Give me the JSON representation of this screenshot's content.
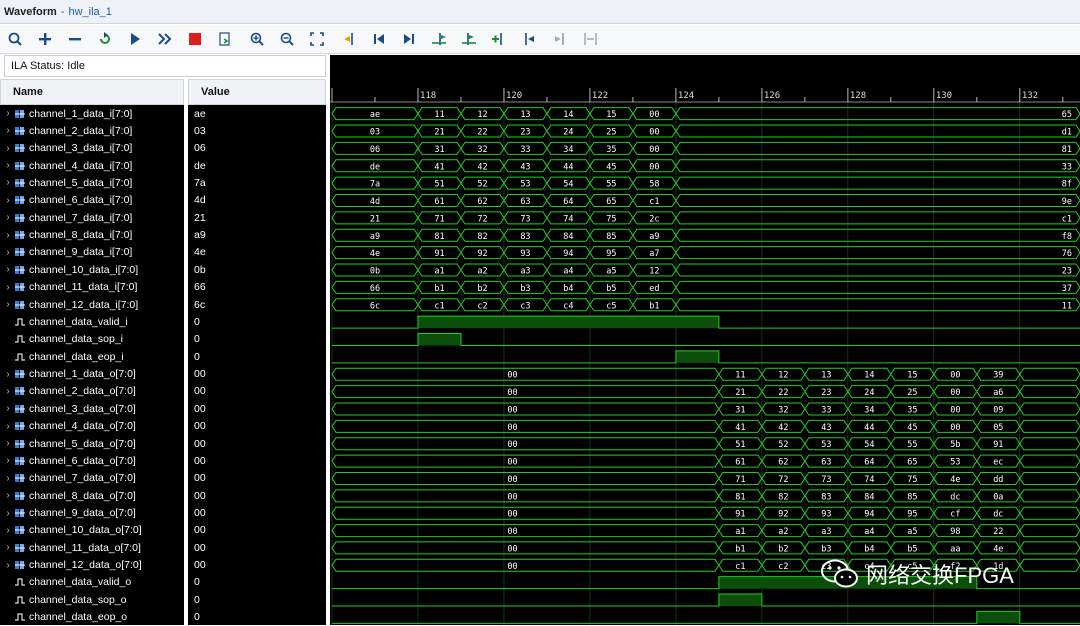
{
  "window": {
    "title": "Waveform",
    "separator": "-",
    "subtitle": "hw_ila_1"
  },
  "toolbar": {
    "buttons": [
      "search-icon",
      "zoom-plus-icon",
      "zoom-minus-icon",
      "refresh-trigger-icon",
      "run-trigger-icon",
      "run-immediate-icon",
      "stop-icon",
      "export-icon",
      "zoom-in-icon",
      "zoom-out-icon",
      "zoom-fit-icon",
      "cursor-icon",
      "go-to-start-icon",
      "go-to-end-icon",
      "add-marker-icon",
      "marker-icon",
      "add-cursor-icon",
      "prev-transition-icon",
      "next-transition-icon",
      "swap-icon"
    ]
  },
  "ila_status": "ILA Status: Idle",
  "columns": {
    "name": "Name",
    "value": "Value"
  },
  "signals": [
    {
      "name": "channel_1_data_i[7:0]",
      "value": "ae",
      "bus": true
    },
    {
      "name": "channel_2_data_i[7:0]",
      "value": "03",
      "bus": true
    },
    {
      "name": "channel_3_data_i[7:0]",
      "value": "06",
      "bus": true
    },
    {
      "name": "channel_4_data_i[7:0]",
      "value": "de",
      "bus": true
    },
    {
      "name": "channel_5_data_i[7:0]",
      "value": "7a",
      "bus": true
    },
    {
      "name": "channel_6_data_i[7:0]",
      "value": "4d",
      "bus": true
    },
    {
      "name": "channel_7_data_i[7:0]",
      "value": "21",
      "bus": true
    },
    {
      "name": "channel_8_data_i[7:0]",
      "value": "a9",
      "bus": true
    },
    {
      "name": "channel_9_data_i[7:0]",
      "value": "4e",
      "bus": true
    },
    {
      "name": "channel_10_data_i[7:0]",
      "value": "0b",
      "bus": true
    },
    {
      "name": "channel_11_data_i[7:0]",
      "value": "66",
      "bus": true
    },
    {
      "name": "channel_12_data_i[7:0]",
      "value": "6c",
      "bus": true
    },
    {
      "name": "channel_data_valid_i",
      "value": "0",
      "bus": false
    },
    {
      "name": "channel_data_sop_i",
      "value": "0",
      "bus": false
    },
    {
      "name": "channel_data_eop_i",
      "value": "0",
      "bus": false
    },
    {
      "name": "channel_1_data_o[7:0]",
      "value": "00",
      "bus": true
    },
    {
      "name": "channel_2_data_o[7:0]",
      "value": "00",
      "bus": true
    },
    {
      "name": "channel_3_data_o[7:0]",
      "value": "00",
      "bus": true
    },
    {
      "name": "channel_4_data_o[7:0]",
      "value": "00",
      "bus": true
    },
    {
      "name": "channel_5_data_o[7:0]",
      "value": "00",
      "bus": true
    },
    {
      "name": "channel_6_data_o[7:0]",
      "value": "00",
      "bus": true
    },
    {
      "name": "channel_7_data_o[7:0]",
      "value": "00",
      "bus": true
    },
    {
      "name": "channel_8_data_o[7:0]",
      "value": "00",
      "bus": true
    },
    {
      "name": "channel_9_data_o[7:0]",
      "value": "00",
      "bus": true
    },
    {
      "name": "channel_10_data_o[7:0]",
      "value": "00",
      "bus": true
    },
    {
      "name": "channel_11_data_o[7:0]",
      "value": "00",
      "bus": true
    },
    {
      "name": "channel_12_data_o[7:0]",
      "value": "00",
      "bus": true
    },
    {
      "name": "channel_data_valid_o",
      "value": "0",
      "bus": false
    },
    {
      "name": "channel_data_sop_o",
      "value": "0",
      "bus": false
    },
    {
      "name": "channel_data_eop_o",
      "value": "0",
      "bus": false
    }
  ],
  "timeline": {
    "labels": [
      "118",
      "120",
      "122",
      "124",
      "126",
      "128",
      "130",
      "132"
    ],
    "start": 116.0,
    "end": 133.4
  },
  "waveforms": [
    {
      "segs": [
        [
          116,
          118,
          "ae"
        ],
        [
          118,
          119,
          "11"
        ],
        [
          119,
          120,
          "12"
        ],
        [
          120,
          121,
          "13"
        ],
        [
          121,
          122,
          "14"
        ],
        [
          122,
          123,
          "15"
        ],
        [
          123,
          124,
          "00"
        ],
        [
          124,
          133.4,
          "65"
        ]
      ]
    },
    {
      "segs": [
        [
          116,
          118,
          "03"
        ],
        [
          118,
          119,
          "21"
        ],
        [
          119,
          120,
          "22"
        ],
        [
          120,
          121,
          "23"
        ],
        [
          121,
          122,
          "24"
        ],
        [
          122,
          123,
          "25"
        ],
        [
          123,
          124,
          "00"
        ],
        [
          124,
          133.4,
          "d1"
        ]
      ]
    },
    {
      "segs": [
        [
          116,
          118,
          "06"
        ],
        [
          118,
          119,
          "31"
        ],
        [
          119,
          120,
          "32"
        ],
        [
          120,
          121,
          "33"
        ],
        [
          121,
          122,
          "34"
        ],
        [
          122,
          123,
          "35"
        ],
        [
          123,
          124,
          "00"
        ],
        [
          124,
          133.4,
          "81"
        ]
      ]
    },
    {
      "segs": [
        [
          116,
          118,
          "de"
        ],
        [
          118,
          119,
          "41"
        ],
        [
          119,
          120,
          "42"
        ],
        [
          120,
          121,
          "43"
        ],
        [
          121,
          122,
          "44"
        ],
        [
          122,
          123,
          "45"
        ],
        [
          123,
          124,
          "00"
        ],
        [
          124,
          133.4,
          "33"
        ]
      ]
    },
    {
      "segs": [
        [
          116,
          118,
          "7a"
        ],
        [
          118,
          119,
          "51"
        ],
        [
          119,
          120,
          "52"
        ],
        [
          120,
          121,
          "53"
        ],
        [
          121,
          122,
          "54"
        ],
        [
          122,
          123,
          "55"
        ],
        [
          123,
          124,
          "58"
        ],
        [
          124,
          133.4,
          "8f"
        ]
      ]
    },
    {
      "segs": [
        [
          116,
          118,
          "4d"
        ],
        [
          118,
          119,
          "61"
        ],
        [
          119,
          120,
          "62"
        ],
        [
          120,
          121,
          "63"
        ],
        [
          121,
          122,
          "64"
        ],
        [
          122,
          123,
          "65"
        ],
        [
          123,
          124,
          "c1"
        ],
        [
          124,
          133.4,
          "9e"
        ]
      ]
    },
    {
      "segs": [
        [
          116,
          118,
          "21"
        ],
        [
          118,
          119,
          "71"
        ],
        [
          119,
          120,
          "72"
        ],
        [
          120,
          121,
          "73"
        ],
        [
          121,
          122,
          "74"
        ],
        [
          122,
          123,
          "75"
        ],
        [
          123,
          124,
          "2c"
        ],
        [
          124,
          133.4,
          "c1"
        ]
      ]
    },
    {
      "segs": [
        [
          116,
          118,
          "a9"
        ],
        [
          118,
          119,
          "81"
        ],
        [
          119,
          120,
          "82"
        ],
        [
          120,
          121,
          "83"
        ],
        [
          121,
          122,
          "84"
        ],
        [
          122,
          123,
          "85"
        ],
        [
          123,
          124,
          "a9"
        ],
        [
          124,
          133.4,
          "f8"
        ]
      ]
    },
    {
      "segs": [
        [
          116,
          118,
          "4e"
        ],
        [
          118,
          119,
          "91"
        ],
        [
          119,
          120,
          "92"
        ],
        [
          120,
          121,
          "93"
        ],
        [
          121,
          122,
          "94"
        ],
        [
          122,
          123,
          "95"
        ],
        [
          123,
          124,
          "a7"
        ],
        [
          124,
          133.4,
          "76"
        ]
      ]
    },
    {
      "segs": [
        [
          116,
          118,
          "0b"
        ],
        [
          118,
          119,
          "a1"
        ],
        [
          119,
          120,
          "a2"
        ],
        [
          120,
          121,
          "a3"
        ],
        [
          121,
          122,
          "a4"
        ],
        [
          122,
          123,
          "a5"
        ],
        [
          123,
          124,
          "12"
        ],
        [
          124,
          133.4,
          "23"
        ]
      ]
    },
    {
      "segs": [
        [
          116,
          118,
          "66"
        ],
        [
          118,
          119,
          "b1"
        ],
        [
          119,
          120,
          "b2"
        ],
        [
          120,
          121,
          "b3"
        ],
        [
          121,
          122,
          "b4"
        ],
        [
          122,
          123,
          "b5"
        ],
        [
          123,
          124,
          "ed"
        ],
        [
          124,
          133.4,
          "37"
        ]
      ]
    },
    {
      "segs": [
        [
          116,
          118,
          "6c"
        ],
        [
          118,
          119,
          "c1"
        ],
        [
          119,
          120,
          "c2"
        ],
        [
          120,
          121,
          "c3"
        ],
        [
          121,
          122,
          "c4"
        ],
        [
          122,
          123,
          "c5"
        ],
        [
          123,
          124,
          "b1"
        ],
        [
          124,
          133.4,
          "11"
        ]
      ]
    },
    {
      "high": [
        [
          118,
          125
        ]
      ]
    },
    {
      "high": [
        [
          118,
          119
        ]
      ]
    },
    {
      "high": [
        [
          124,
          125
        ]
      ]
    },
    {
      "segs": [
        [
          116,
          125,
          "00"
        ],
        [
          125,
          126,
          "11"
        ],
        [
          126,
          127,
          "12"
        ],
        [
          127,
          128,
          "13"
        ],
        [
          128,
          129,
          "14"
        ],
        [
          129,
          130,
          "15"
        ],
        [
          130,
          131,
          "00"
        ],
        [
          131,
          132,
          "39"
        ],
        [
          132,
          133.4,
          ""
        ]
      ]
    },
    {
      "segs": [
        [
          116,
          125,
          "00"
        ],
        [
          125,
          126,
          "21"
        ],
        [
          126,
          127,
          "22"
        ],
        [
          127,
          128,
          "23"
        ],
        [
          128,
          129,
          "24"
        ],
        [
          129,
          130,
          "25"
        ],
        [
          130,
          131,
          "00"
        ],
        [
          131,
          132,
          "a6"
        ],
        [
          132,
          133.4,
          ""
        ]
      ]
    },
    {
      "segs": [
        [
          116,
          125,
          "00"
        ],
        [
          125,
          126,
          "31"
        ],
        [
          126,
          127,
          "32"
        ],
        [
          127,
          128,
          "33"
        ],
        [
          128,
          129,
          "34"
        ],
        [
          129,
          130,
          "35"
        ],
        [
          130,
          131,
          "00"
        ],
        [
          131,
          132,
          "09"
        ],
        [
          132,
          133.4,
          ""
        ]
      ]
    },
    {
      "segs": [
        [
          116,
          125,
          "00"
        ],
        [
          125,
          126,
          "41"
        ],
        [
          126,
          127,
          "42"
        ],
        [
          127,
          128,
          "43"
        ],
        [
          128,
          129,
          "44"
        ],
        [
          129,
          130,
          "45"
        ],
        [
          130,
          131,
          "00"
        ],
        [
          131,
          132,
          "05"
        ],
        [
          132,
          133.4,
          ""
        ]
      ]
    },
    {
      "segs": [
        [
          116,
          125,
          "00"
        ],
        [
          125,
          126,
          "51"
        ],
        [
          126,
          127,
          "52"
        ],
        [
          127,
          128,
          "53"
        ],
        [
          128,
          129,
          "54"
        ],
        [
          129,
          130,
          "55"
        ],
        [
          130,
          131,
          "5b"
        ],
        [
          131,
          132,
          "91"
        ],
        [
          132,
          133.4,
          ""
        ]
      ]
    },
    {
      "segs": [
        [
          116,
          125,
          "00"
        ],
        [
          125,
          126,
          "61"
        ],
        [
          126,
          127,
          "62"
        ],
        [
          127,
          128,
          "63"
        ],
        [
          128,
          129,
          "64"
        ],
        [
          129,
          130,
          "65"
        ],
        [
          130,
          131,
          "53"
        ],
        [
          131,
          132,
          "ec"
        ],
        [
          132,
          133.4,
          ""
        ]
      ]
    },
    {
      "segs": [
        [
          116,
          125,
          "00"
        ],
        [
          125,
          126,
          "71"
        ],
        [
          126,
          127,
          "72"
        ],
        [
          127,
          128,
          "73"
        ],
        [
          128,
          129,
          "74"
        ],
        [
          129,
          130,
          "75"
        ],
        [
          130,
          131,
          "4e"
        ],
        [
          131,
          132,
          "dd"
        ],
        [
          132,
          133.4,
          ""
        ]
      ]
    },
    {
      "segs": [
        [
          116,
          125,
          "00"
        ],
        [
          125,
          126,
          "81"
        ],
        [
          126,
          127,
          "82"
        ],
        [
          127,
          128,
          "83"
        ],
        [
          128,
          129,
          "84"
        ],
        [
          129,
          130,
          "85"
        ],
        [
          130,
          131,
          "dc"
        ],
        [
          131,
          132,
          "0a"
        ],
        [
          132,
          133.4,
          ""
        ]
      ]
    },
    {
      "segs": [
        [
          116,
          125,
          "00"
        ],
        [
          125,
          126,
          "91"
        ],
        [
          126,
          127,
          "92"
        ],
        [
          127,
          128,
          "93"
        ],
        [
          128,
          129,
          "94"
        ],
        [
          129,
          130,
          "95"
        ],
        [
          130,
          131,
          "cf"
        ],
        [
          131,
          132,
          "dc"
        ],
        [
          132,
          133.4,
          ""
        ]
      ]
    },
    {
      "segs": [
        [
          116,
          125,
          "00"
        ],
        [
          125,
          126,
          "a1"
        ],
        [
          126,
          127,
          "a2"
        ],
        [
          127,
          128,
          "a3"
        ],
        [
          128,
          129,
          "a4"
        ],
        [
          129,
          130,
          "a5"
        ],
        [
          130,
          131,
          "98"
        ],
        [
          131,
          132,
          "22"
        ],
        [
          132,
          133.4,
          ""
        ]
      ]
    },
    {
      "segs": [
        [
          116,
          125,
          "00"
        ],
        [
          125,
          126,
          "b1"
        ],
        [
          126,
          127,
          "b2"
        ],
        [
          127,
          128,
          "b3"
        ],
        [
          128,
          129,
          "b4"
        ],
        [
          129,
          130,
          "b5"
        ],
        [
          130,
          131,
          "aa"
        ],
        [
          131,
          132,
          "4e"
        ],
        [
          132,
          133.4,
          ""
        ]
      ]
    },
    {
      "segs": [
        [
          116,
          125,
          "00"
        ],
        [
          125,
          126,
          "c1"
        ],
        [
          126,
          127,
          "c2"
        ],
        [
          127,
          128,
          "c3"
        ],
        [
          128,
          129,
          "c4"
        ],
        [
          129,
          130,
          "c5"
        ],
        [
          130,
          131,
          "f2"
        ],
        [
          131,
          132,
          "1d"
        ],
        [
          132,
          133.4,
          ""
        ]
      ]
    },
    {
      "high": [
        [
          125,
          131
        ]
      ]
    },
    {
      "high": [
        [
          125,
          126
        ]
      ]
    },
    {
      "high": [
        [
          131,
          132
        ]
      ]
    }
  ],
  "colors": {
    "wave": "#22cc22",
    "fill": "#0b4f0b",
    "text": "#ffffff",
    "grid": "#3a8a3a"
  },
  "watermark": "网络交换FPGA"
}
